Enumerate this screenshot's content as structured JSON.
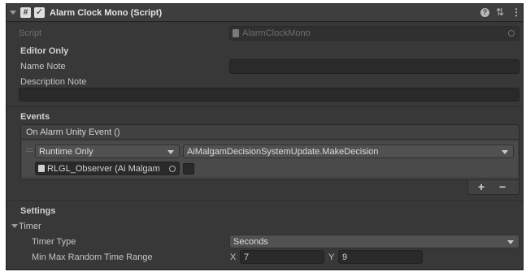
{
  "component": {
    "title": "Alarm Clock Mono (Script)",
    "script_label": "Script",
    "script_value": "AlarmClockMono"
  },
  "editor_only": {
    "header": "Editor Only",
    "name_note_label": "Name Note",
    "name_note_value": "",
    "description_note_label": "Description Note",
    "description_note_value": ""
  },
  "events": {
    "header": "Events",
    "event_label": "On Alarm Unity Event ()",
    "listener": {
      "call_state": "Runtime Only",
      "function": "AiMalgamDecisionSystemUpdate.MakeDecision",
      "target_object": "RLGL_Observer (Ai Malgam",
      "checkbox_checked": false
    },
    "add_button": "+",
    "remove_button": "−"
  },
  "settings": {
    "header": "Settings",
    "timer_foldout": "Timer",
    "timer_type_label": "Timer Type",
    "timer_type_value": "Seconds",
    "range_label": "Min Max Random Time Range",
    "x_label": "X",
    "x_value": "7",
    "y_label": "Y",
    "y_value": "9"
  }
}
